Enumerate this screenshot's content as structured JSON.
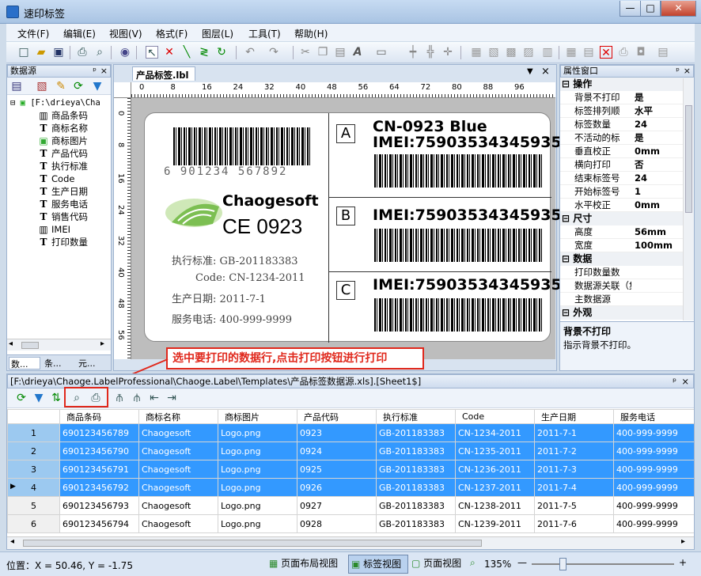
{
  "window": {
    "title": "速印标签",
    "min": "—",
    "max": "□",
    "close": "✕"
  },
  "menu": [
    "文件(F)",
    "编辑(E)",
    "视图(V)",
    "格式(F)",
    "图层(L)",
    "工具(T)",
    "帮助(H)"
  ],
  "datasource": {
    "title": "数据源",
    "root": "[F:\\drieya\\Cha",
    "items": [
      {
        "icon": "barcode",
        "label": "商品条码"
      },
      {
        "icon": "T",
        "label": "商标名称"
      },
      {
        "icon": "image",
        "label": "商标图片"
      },
      {
        "icon": "T",
        "label": "产品代码"
      },
      {
        "icon": "T",
        "label": "执行标准"
      },
      {
        "icon": "T",
        "label": "Code"
      },
      {
        "icon": "T",
        "label": "生产日期"
      },
      {
        "icon": "T",
        "label": "服务电话"
      },
      {
        "icon": "T",
        "label": "销售代码"
      },
      {
        "icon": "barcode",
        "label": "IMEI"
      },
      {
        "icon": "T",
        "label": "打印数量"
      }
    ],
    "tabs": [
      "数...",
      "条...",
      "元..."
    ]
  },
  "doc_tab": "产品标签.lbl",
  "ruler_h": [
    "0",
    "8",
    "16",
    "24",
    "32",
    "40",
    "48",
    "56",
    "64",
    "72",
    "80",
    "88",
    "96"
  ],
  "ruler_v": [
    "0",
    "8",
    "16",
    "24",
    "32",
    "40",
    "48",
    "56"
  ],
  "label": {
    "ean_digits": "6 901234 567892",
    "brand": "Chaogesoft",
    "ce": "CE",
    "ce_num": "0923",
    "std": "执行标准: GB-201183383",
    "code": "Code: CN-1234-2011",
    "date": "生产日期: 2011-7-1",
    "phone": "服务电话: 400-999-9999",
    "boxA": "A",
    "boxB": "B",
    "boxC": "C",
    "blue": "CN-0923 Blue",
    "imei": "IMEI:75903534345935"
  },
  "callout": "选中要打印的数据行,点击打印按钮进行打印",
  "props": {
    "title": "属性窗口",
    "groups": [
      {
        "name": "操作",
        "rows": [
          [
            "背景不打印",
            "是"
          ],
          [
            "标签排列顺",
            "水平"
          ],
          [
            "标签数量",
            "24"
          ],
          [
            "不活动的标",
            "是"
          ],
          [
            "垂直校正",
            "0mm"
          ],
          [
            "横向打印",
            "否"
          ],
          [
            "结束标签号",
            "24"
          ],
          [
            "开始标签号",
            "1"
          ],
          [
            "水平校正",
            "0mm"
          ]
        ]
      },
      {
        "name": "尺寸",
        "rows": [
          [
            "高度",
            "56mm"
          ],
          [
            "宽度",
            "100mm"
          ]
        ]
      },
      {
        "name": "数据",
        "rows": [
          [
            "打印数量数",
            ""
          ],
          [
            "数据源关联（集合）",
            ""
          ],
          [
            "主数据源",
            ""
          ]
        ]
      },
      {
        "name": "外观",
        "rows": []
      }
    ],
    "desc_title": "背景不打印",
    "desc_text": "指示背景不打印。"
  },
  "datagrid": {
    "path": "[F:\\drieya\\Chaoge.LabelProfessional\\Chaoge.Label\\Templates\\产品标签数据源.xls].[Sheet1$]",
    "columns": [
      "商品条码",
      "商标名称",
      "商标图片",
      "产品代码",
      "执行标准",
      "Code",
      "生产日期",
      "服务电话"
    ],
    "rows": [
      {
        "n": "1",
        "sel": true,
        "cells": [
          "690123456789",
          "Chaogesoft",
          "Logo.png",
          "0923",
          "GB-201183383",
          "CN-1234-2011",
          "2011-7-1",
          "400-999-9999"
        ]
      },
      {
        "n": "2",
        "sel": true,
        "cells": [
          "690123456790",
          "Chaogesoft",
          "Logo.png",
          "0924",
          "GB-201183383",
          "CN-1235-2011",
          "2011-7-2",
          "400-999-9999"
        ]
      },
      {
        "n": "3",
        "sel": true,
        "cells": [
          "690123456791",
          "Chaogesoft",
          "Logo.png",
          "0925",
          "GB-201183383",
          "CN-1236-2011",
          "2011-7-3",
          "400-999-9999"
        ]
      },
      {
        "n": "4",
        "sel": true,
        "current": true,
        "cells": [
          "690123456792",
          "Chaogesoft",
          "Logo.png",
          "0926",
          "GB-201183383",
          "CN-1237-2011",
          "2011-7-4",
          "400-999-9999"
        ]
      },
      {
        "n": "5",
        "sel": false,
        "cells": [
          "690123456793",
          "Chaogesoft",
          "Logo.png",
          "0927",
          "GB-201183383",
          "CN-1238-2011",
          "2011-7-5",
          "400-999-9999"
        ]
      },
      {
        "n": "6",
        "sel": false,
        "cells": [
          "690123456794",
          "Chaogesoft",
          "Logo.png",
          "0928",
          "GB-201183383",
          "CN-1239-2011",
          "2011-7-6",
          "400-999-9999"
        ]
      }
    ]
  },
  "status": {
    "pos": "位置：X = 50.46, Y = -1.75",
    "layout_view": "页面布局视图",
    "label_view": "标签视图",
    "page_view": "页面视图",
    "zoom": "135%"
  }
}
